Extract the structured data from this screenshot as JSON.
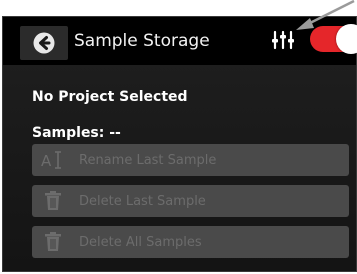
{
  "header": {
    "title": "Sample Storage",
    "back_icon": "back-arrow-circle-icon",
    "settings_icon": "sliders-icon",
    "toggle_on": true,
    "toggle_color": "#e5262a"
  },
  "status": {
    "project": "No Project Selected",
    "samples": "Samples: --"
  },
  "actions": [
    {
      "label": "Rename Last Sample",
      "icon": "rename-icon",
      "enabled": false
    },
    {
      "label": "Delete Last Sample",
      "icon": "trash-icon",
      "enabled": false
    },
    {
      "label": "Delete All Samples",
      "icon": "trash-icon",
      "enabled": false
    }
  ],
  "colors": {
    "background": "#1b1b1b",
    "header": "#000000",
    "button_disabled": "#4a4a4a",
    "text_disabled": "#6c6c6c"
  }
}
